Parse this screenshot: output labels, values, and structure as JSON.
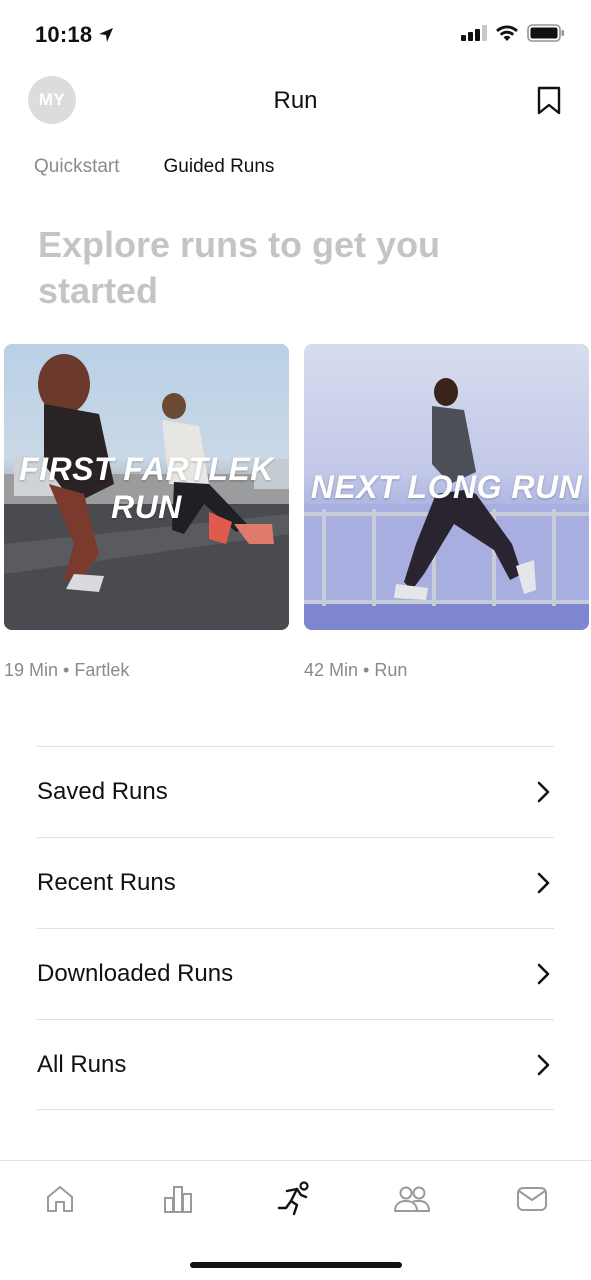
{
  "status_bar": {
    "time": "10:18"
  },
  "header": {
    "avatar_initials": "MY",
    "title": "Run"
  },
  "tabs": [
    {
      "label": "Quickstart",
      "active": false
    },
    {
      "label": "Guided Runs",
      "active": true
    }
  ],
  "headline": "Explore runs to get you started",
  "cards": [
    {
      "title_line1": "FIRST FARTLEK",
      "title_line2": "RUN",
      "meta": "19 Min • Fartlek"
    },
    {
      "title_line1": "NEXT LONG RUN",
      "meta": "42 Min • Run"
    }
  ],
  "menu": [
    {
      "label": "Saved Runs"
    },
    {
      "label": "Recent Runs"
    },
    {
      "label": "Downloaded Runs"
    },
    {
      "label": "All Runs"
    }
  ],
  "bottom_nav": [
    {
      "icon": "home-icon",
      "active": false
    },
    {
      "icon": "activity-bar-chart-icon",
      "active": false
    },
    {
      "icon": "runner-icon",
      "active": true
    },
    {
      "icon": "club-people-icon",
      "active": false
    },
    {
      "icon": "inbox-icon",
      "active": false
    }
  ],
  "colors": {
    "muted_text": "#8b8b8b",
    "headline": "#c4c4c4",
    "divider": "#e2e2e2"
  }
}
